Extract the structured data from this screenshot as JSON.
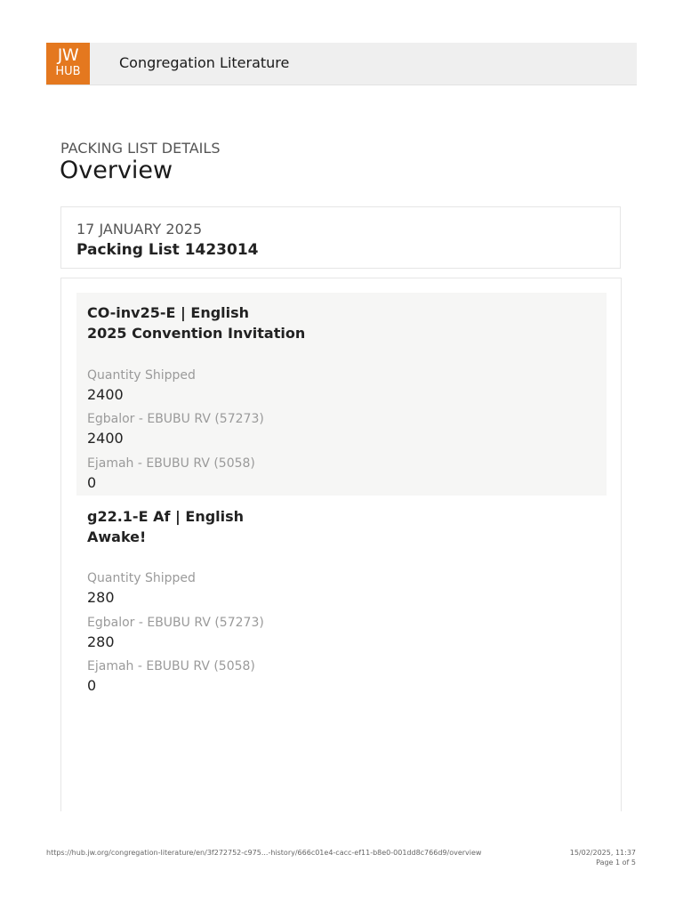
{
  "header": {
    "logo_top": "JW",
    "logo_bottom": "HUB",
    "logo_color": "#e4781f",
    "section_title": "Congregation Literature"
  },
  "page": {
    "eyebrow": "PACKING LIST DETAILS",
    "title": "Overview"
  },
  "summary": {
    "date": "17 JANUARY 2025",
    "packing_list": "Packing List 1423014"
  },
  "items": [
    {
      "code": "CO-inv25-E | English",
      "name": "2025 Convention Invitation",
      "fields": [
        {
          "label": "Quantity Shipped",
          "value": "2400"
        },
        {
          "label": "Egbalor - EBUBU RV (57273)",
          "value": "2400"
        },
        {
          "label": "Ejamah - EBUBU RV (5058)",
          "value": "0"
        }
      ]
    },
    {
      "code": "g22.1-E Af | English",
      "name": "Awake!",
      "fields": [
        {
          "label": "Quantity Shipped",
          "value": "280"
        },
        {
          "label": "Egbalor - EBUBU RV (57273)",
          "value": "280"
        },
        {
          "label": "Ejamah - EBUBU RV (5058)",
          "value": "0"
        }
      ]
    }
  ],
  "footer": {
    "url": "https://hub.jw.org/congregation-literature/en/3f272752-c975...-history/666c01e4-cacc-ef11-b8e0-001dd8c766d9/overview",
    "datetime": "15/02/2025, 11:37",
    "page": "Page 1 of 5"
  }
}
